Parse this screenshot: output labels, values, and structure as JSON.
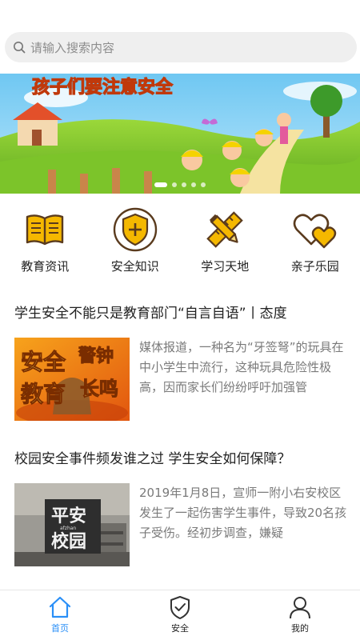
{
  "search": {
    "placeholder": "请输入搜索内容",
    "icon": "search-icon"
  },
  "banner": {
    "text": "孩子们要注意安全",
    "slides_total": 5,
    "active_slide": 1
  },
  "categories": [
    {
      "label": "教育资讯",
      "icon": "open-book-icon",
      "color": "#f5b800"
    },
    {
      "label": "安全知识",
      "icon": "shield-plus-icon",
      "color": "#f5b800"
    },
    {
      "label": "学习天地",
      "icon": "pencil-ruler-icon",
      "color": "#f5b800"
    },
    {
      "label": "亲子乐园",
      "icon": "two-hearts-icon",
      "color": "#f5b800"
    }
  ],
  "articles": [
    {
      "title": "学生安全不能只是教育部门“自言自语”丨态度",
      "summary": "媒体报道，一种名为“牙签弩”的玩具在中小学生中流行，这种玩具危险性极高，因而家长们纷纷呼吁加强管",
      "thumb_text": [
        "安全",
        "警钟",
        "教育",
        "长鸣"
      ]
    },
    {
      "title": "校园安全事件频发谁之过 学生安全如何保障？",
      "summary": "2019年1月8日，宣师一附小右安校区发生了一起伤害学生事件，导致20名孩子受伤。经初步调查，嫌疑",
      "thumb_text": [
        "平安",
        "afzhan",
        "校园"
      ]
    }
  ],
  "tabbar": [
    {
      "label": "首页",
      "icon": "home-icon",
      "active": true
    },
    {
      "label": "安全",
      "icon": "shield-check-icon",
      "active": false
    },
    {
      "label": "我的",
      "icon": "user-icon",
      "active": false
    }
  ],
  "colors": {
    "accent": "#2a8ff7",
    "icon_yellow": "#f5b800",
    "icon_dark": "#5a3b1e"
  }
}
